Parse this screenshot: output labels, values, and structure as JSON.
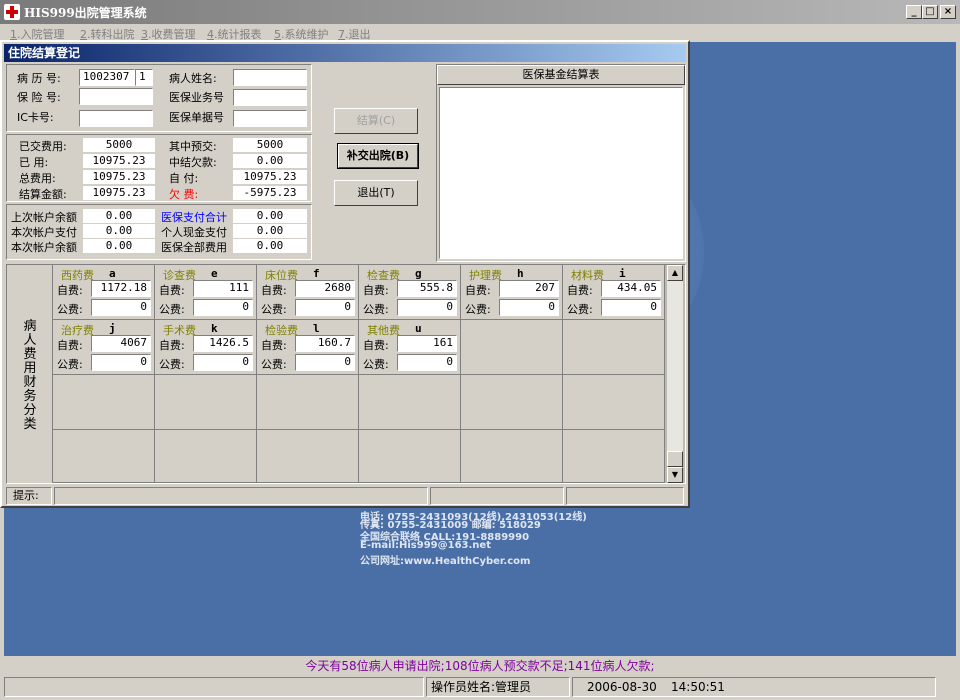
{
  "window": {
    "title": "HIS999出院管理系统"
  },
  "menu": [
    {
      "key": "1",
      "label": ".入院管理"
    },
    {
      "key": "2",
      "label": ".转科出院"
    },
    {
      "key": "3",
      "label": ".收费管理"
    },
    {
      "key": "4",
      "label": ".统计报表"
    },
    {
      "key": "5",
      "label": ".系统维护"
    },
    {
      "key": "7",
      "label": ".退出"
    }
  ],
  "dialog": {
    "title": "住院结算登记",
    "patient": {
      "record_no_label": "病 历 号:",
      "record_no": "1002307",
      "record_seq": "1",
      "insurance_no_label": "保 险 号:",
      "insurance_no": "",
      "ic_card_label": "IC卡号:",
      "ic_card": "",
      "name_label": "病人姓名:",
      "name": "",
      "ins_business_label": "医保业务号",
      "ins_business": "",
      "ins_bill_label": "医保单据号",
      "ins_bill": ""
    },
    "fees": {
      "paid_label": "已交费用:",
      "paid": "5000",
      "prepay_label": "其中预交:",
      "prepay": "5000",
      "used_label": "已    用:",
      "used": "10975.23",
      "mid_debt_label": "中结欠款:",
      "mid_debt": "0.00",
      "total_label": "总费用:",
      "total": "10975.23",
      "self_pay_label": "自    付:",
      "self_pay": "10975.23",
      "settle_label": "结算金额:",
      "settle": "10975.23",
      "owed_label": "欠    费:",
      "owed": "-5975.23"
    },
    "accounts": {
      "last_balance_label": "上次帐户余额",
      "last_balance": "0.00",
      "this_pay_label": "本次帐户支付",
      "this_pay": "0.00",
      "this_balance_label": "本次帐户余额",
      "this_balance": "0.00",
      "ins_total_label": "医保支付合计",
      "ins_total": "0.00",
      "cash_label": "个人现金支付",
      "cash": "0.00",
      "ins_all_label": "医保全部费用",
      "ins_all": "0.00"
    },
    "buttons": {
      "settle": "结算(C)",
      "supplement": "补交出院(B)",
      "exit": "退出(T)"
    },
    "fund_table_title": "医保基金结算表",
    "side_label": "病人费用财务分类",
    "self_label": "自费:",
    "public_label": "公费:",
    "categories": [
      {
        "name": "西药费",
        "code": "a",
        "self": "1172.18",
        "public": "0"
      },
      {
        "name": "诊查费",
        "code": "e",
        "self": "111",
        "public": "0"
      },
      {
        "name": "床位费",
        "code": "f",
        "self": "2680",
        "public": "0"
      },
      {
        "name": "检查费",
        "code": "g",
        "self": "555.8",
        "public": "0"
      },
      {
        "name": "护理费",
        "code": "h",
        "self": "207",
        "public": "0"
      },
      {
        "name": "材料费",
        "code": "i",
        "self": "434.05",
        "public": "0"
      },
      {
        "name": "治疗费",
        "code": "j",
        "self": "4067",
        "public": "0"
      },
      {
        "name": "手术费",
        "code": "k",
        "self": "1426.5",
        "public": "0"
      },
      {
        "name": "检验费",
        "code": "l",
        "self": "160.7",
        "public": "0"
      },
      {
        "name": "其他费",
        "code": "u",
        "self": "161",
        "public": "0"
      }
    ],
    "hint_label": "提示:"
  },
  "desktop": {
    "contact": [
      "电话: 0755-2431093(12线),2431053(12线)",
      "传真: 0755-2431009 邮编: 518029",
      "全国综合联络 CALL:191-8889990",
      "E-mail:His999@163.net",
      "公司网址:www.HealthCyber.com"
    ]
  },
  "notice": "今天有58位病人申请出院;108位病人预交款不足;141位病人欠款;",
  "status": {
    "operator": "操作员姓名:管理员",
    "date": "2006-08-30",
    "time": "14:50:51"
  },
  "colors": {
    "notice": "#8000a0",
    "owed": "#ff0000",
    "ins_total": "#0000ff",
    "category": "#808000"
  }
}
